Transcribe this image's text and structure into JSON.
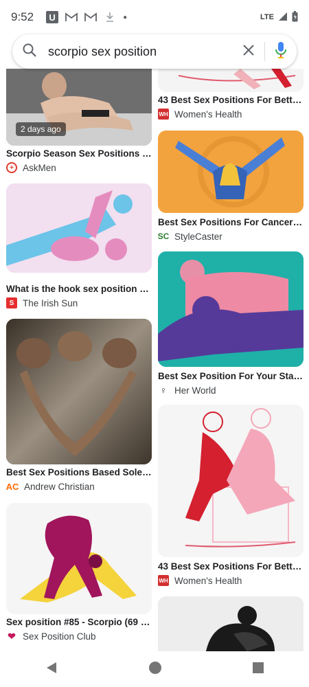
{
  "status_bar": {
    "time": "9:52",
    "network": "LTE"
  },
  "search": {
    "query": "scorpio sex position"
  },
  "results": [
    {
      "title": "Scorpio Season Sex Positions - ...",
      "source": "AskMen",
      "badge": "2 days ago",
      "logo_color": "#e03a2f"
    },
    {
      "title": "What is the hook sex position a...",
      "source": "The Irish Sun",
      "logo_color": "#e52e2e"
    },
    {
      "title": "Best Sex Positions Based Solely ...",
      "source": "Andrew Christian",
      "logo_color": "#ff6a00"
    },
    {
      "title": "Sex position #85 - Scorpio (69 p...",
      "source": "Sex Position Club",
      "logo_color": "#c2185b"
    },
    {
      "title": "43 Best Sex Positions For Better ...",
      "source": "Women's Health",
      "logo_color": "#d32f2f"
    },
    {
      "title": "Best Sex Positions For Cancer: T...",
      "source": "StyleCaster",
      "logo_color": "#2e7d32"
    },
    {
      "title": "Best Sex Position For Your Star S...",
      "source": "Her World",
      "logo_color": "#333333"
    },
    {
      "title": "43 Best Sex Positions For Better ...",
      "source": "Women's Health",
      "logo_color": "#d32f2f"
    }
  ],
  "logo_letters": {
    "askmen": "+",
    "irishsun": "S",
    "andrew": "AC",
    "sexclub": "❤",
    "wh": "WH",
    "sc": "SC",
    "herworld": "♀"
  }
}
